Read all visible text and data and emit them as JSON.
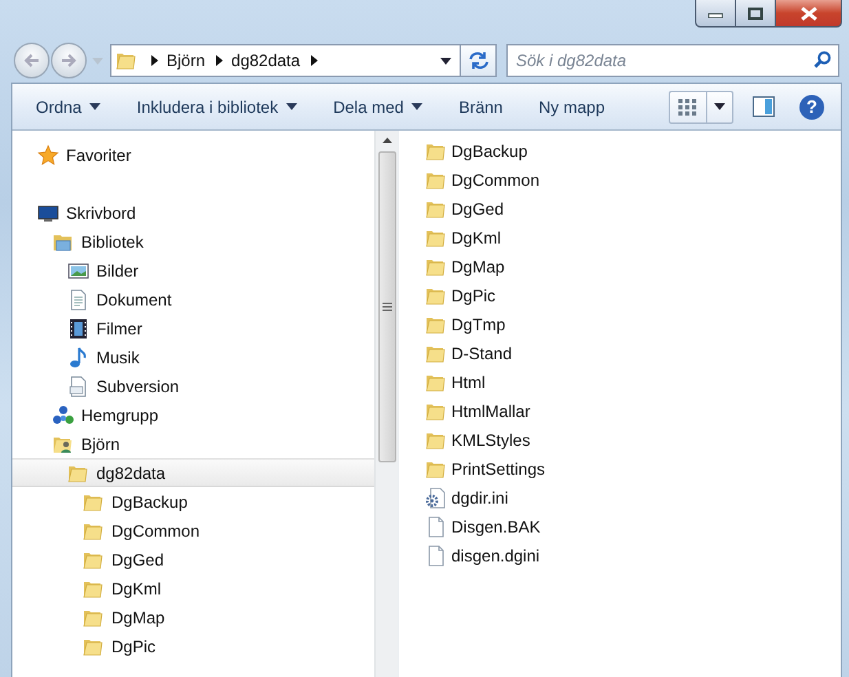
{
  "address": {
    "crumbs": [
      "Björn",
      "dg82data"
    ]
  },
  "search": {
    "placeholder": "Sök i dg82data"
  },
  "toolbar": {
    "buttons": [
      {
        "label": "Ordna",
        "dropdown": true
      },
      {
        "label": "Inkludera i bibliotek",
        "dropdown": true
      },
      {
        "label": "Dela med",
        "dropdown": true
      },
      {
        "label": "Bränn",
        "dropdown": false
      },
      {
        "label": "Ny mapp",
        "dropdown": false
      }
    ],
    "help": "?"
  },
  "navigation": {
    "groups": [
      {
        "items": [
          {
            "label": "Favoriter",
            "kind": "star",
            "selected": false
          }
        ]
      },
      {
        "items": [
          {
            "label": "Skrivbord",
            "kind": "desktop",
            "selected": false,
            "children": [
              {
                "label": "Bibliotek",
                "kind": "library",
                "selected": false,
                "children": [
                  {
                    "label": "Bilder",
                    "kind": "pictures",
                    "selected": false
                  },
                  {
                    "label": "Dokument",
                    "kind": "documents",
                    "selected": false
                  },
                  {
                    "label": "Filmer",
                    "kind": "videos",
                    "selected": false
                  },
                  {
                    "label": "Musik",
                    "kind": "music",
                    "selected": false
                  },
                  {
                    "label": "Subversion",
                    "kind": "document",
                    "selected": false
                  }
                ]
              },
              {
                "label": "Hemgrupp",
                "kind": "homegroup",
                "selected": false
              },
              {
                "label": "Björn",
                "kind": "user",
                "selected": false,
                "children": [
                  {
                    "label": "dg82data",
                    "kind": "folder",
                    "selected": true,
                    "children": [
                      {
                        "label": "DgBackup",
                        "kind": "folder",
                        "selected": false
                      },
                      {
                        "label": "DgCommon",
                        "kind": "folder",
                        "selected": false
                      },
                      {
                        "label": "DgGed",
                        "kind": "folder",
                        "selected": false
                      },
                      {
                        "label": "DgKml",
                        "kind": "folder",
                        "selected": false
                      },
                      {
                        "label": "DgMap",
                        "kind": "folder",
                        "selected": false
                      },
                      {
                        "label": "DgPic",
                        "kind": "folder",
                        "selected": false
                      }
                    ]
                  }
                ]
              }
            ]
          }
        ]
      }
    ]
  },
  "files": [
    {
      "name": "DgBackup",
      "kind": "folder"
    },
    {
      "name": "DgCommon",
      "kind": "folder"
    },
    {
      "name": "DgGed",
      "kind": "folder"
    },
    {
      "name": "DgKml",
      "kind": "folder"
    },
    {
      "name": "DgMap",
      "kind": "folder"
    },
    {
      "name": "DgPic",
      "kind": "folder"
    },
    {
      "name": "DgTmp",
      "kind": "folder"
    },
    {
      "name": "D-Stand",
      "kind": "folder"
    },
    {
      "name": "Html",
      "kind": "folder"
    },
    {
      "name": "HtmlMallar",
      "kind": "folder"
    },
    {
      "name": "KMLStyles",
      "kind": "folder"
    },
    {
      "name": "PrintSettings",
      "kind": "folder"
    },
    {
      "name": "dgdir.ini",
      "kind": "settings"
    },
    {
      "name": "Disgen.BAK",
      "kind": "file"
    },
    {
      "name": "disgen.dgini",
      "kind": "file"
    }
  ]
}
